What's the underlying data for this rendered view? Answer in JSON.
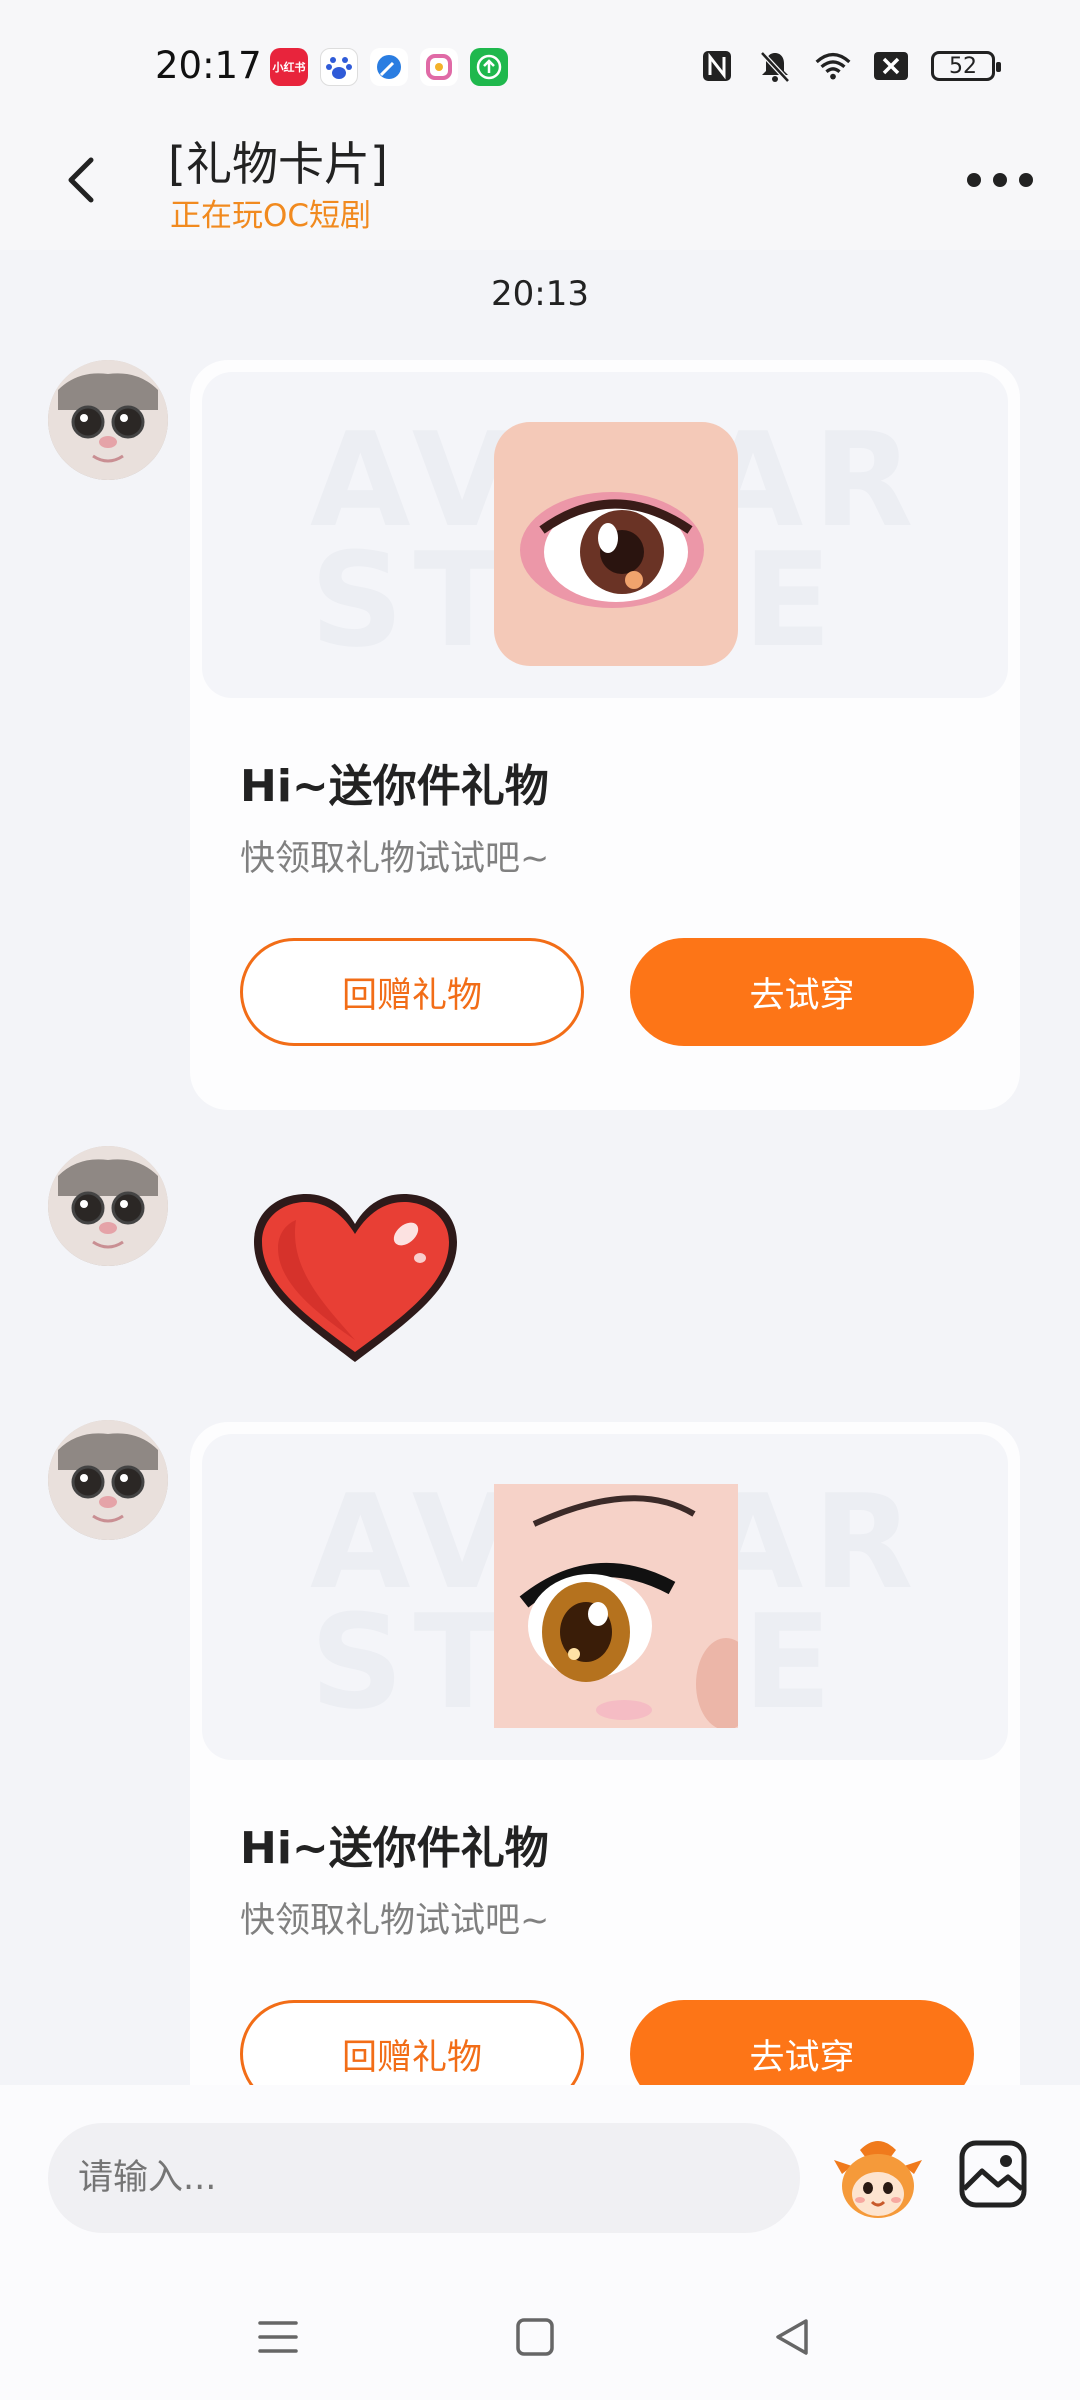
{
  "status_bar": {
    "time": "20:17",
    "apps": [
      {
        "name": "xiaohongshu-icon",
        "label": "小红书",
        "color": "#e8243c"
      },
      {
        "name": "baidu-icon",
        "label": "",
        "color": "#2f5bd8"
      },
      {
        "name": "browser-icon",
        "label": "",
        "color": "#2a7de1"
      },
      {
        "name": "kuan-icon",
        "label": "",
        "color": "#e06aa6"
      },
      {
        "name": "update-icon",
        "label": "",
        "color": "#1fb84d"
      }
    ],
    "battery": "52"
  },
  "header": {
    "title": "[礼物卡片]",
    "subtitle": "正在玩OC短剧"
  },
  "chat": {
    "time_divider": "20:13",
    "messages": [
      {
        "type": "gift_card",
        "watermark": "AVATAR STORE",
        "title": "Hi~送你件礼物",
        "desc": "快领取礼物试试吧~",
        "return_gift_label": "回赠礼物",
        "try_on_label": "去试穿"
      },
      {
        "type": "sticker",
        "sticker": "heart-icon"
      },
      {
        "type": "gift_card",
        "watermark": "AVATAR STORE",
        "title": "Hi~送你件礼物",
        "desc": "快领取礼物试试吧~",
        "return_gift_label": "回赠礼物",
        "try_on_label": "去试穿"
      }
    ]
  },
  "input": {
    "placeholder": "请输入..."
  },
  "colors": {
    "accent": "#fd7517",
    "subtitle": "#f18a1f",
    "background": "#f3f4f8"
  }
}
